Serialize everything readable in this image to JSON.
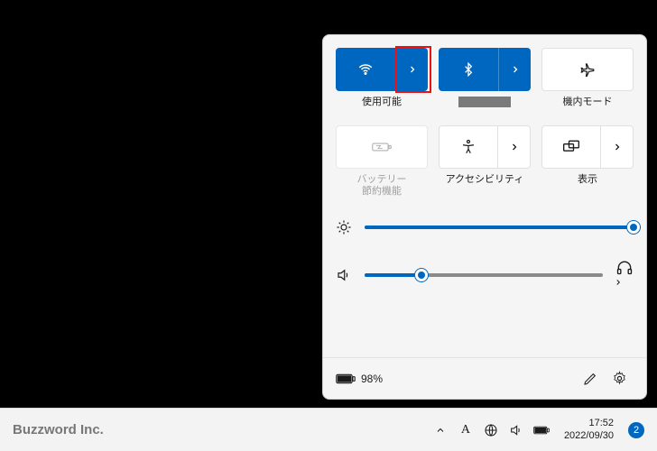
{
  "panel": {
    "tiles": {
      "wifi": {
        "label": "使用可能",
        "state": "on",
        "has_expand": true
      },
      "bluetooth": {
        "label": "",
        "state": "on",
        "has_expand": true,
        "redacted": true
      },
      "airplane": {
        "label": "機内モード",
        "state": "off",
        "has_expand": false
      },
      "battery": {
        "label": "バッテリー\n節約機能",
        "state": "disabled",
        "has_expand": false
      },
      "a11y": {
        "label": "アクセシビリティ",
        "state": "off",
        "has_expand": true
      },
      "display": {
        "label": "表示",
        "state": "off",
        "has_expand": true
      }
    },
    "brightness_pct": 100,
    "volume_pct": 24,
    "battery_text": "98%",
    "highlight_on_wifi_expand": true
  },
  "taskbar": {
    "watermark": "Buzzword Inc.",
    "time": "17:52",
    "date": "2022/09/30",
    "notif_count": "2"
  }
}
